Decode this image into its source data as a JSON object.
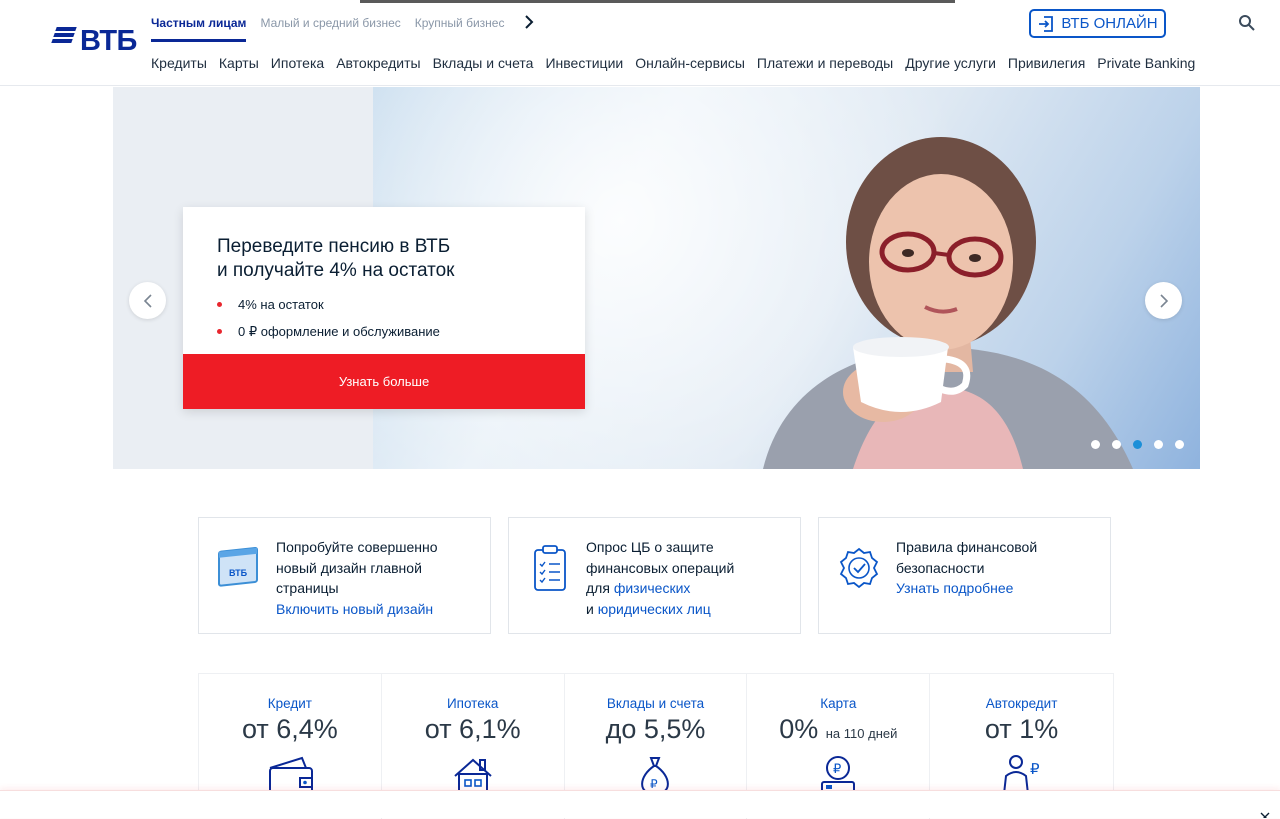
{
  "brand": {
    "logo_text": "ВТБ",
    "color": "#0a2896"
  },
  "segments": [
    {
      "label": "Частным лицам",
      "active": true
    },
    {
      "label": "Малый и средний бизнес",
      "active": false
    },
    {
      "label": "Крупный бизнес",
      "active": false
    }
  ],
  "header": {
    "online_label": "ВТБ ОНЛАЙН",
    "accent": "#0a56c8"
  },
  "nav": [
    "Кредиты",
    "Карты",
    "Ипотека",
    "Автокредиты",
    "Вклады и счета",
    "Инвестиции",
    "Онлайн-сервисы",
    "Платежи и переводы",
    "Другие услуги",
    "Привилегия",
    "Private Banking"
  ],
  "hero": {
    "title_line1": "Переведите пенсию в ВТБ",
    "title_line2": "и получайте 4% на остаток",
    "bullets": [
      "4% на остаток",
      "0 ₽ оформление и обслуживание"
    ],
    "cta": "Узнать больше",
    "cta_color": "#ee1c25",
    "slides_total": 5,
    "active_slide": 3
  },
  "info_cards": [
    {
      "text_line": "Попробуйте совершенно новый дизайн главной страницы",
      "link": "Включить новый дизайн"
    },
    {
      "text_line": "Опрос ЦБ о защите финансовых операций",
      "prefix1": "для ",
      "link1": "физических",
      "prefix2": "и ",
      "link2": "юридических лиц"
    },
    {
      "text_line": "Правила финансовой безопасности",
      "link": "Узнать подробнее"
    }
  ],
  "products": [
    {
      "name": "Кредит",
      "rate": "от 6,4%",
      "suffix": ""
    },
    {
      "name": "Ипотека",
      "rate": "от 6,1%",
      "suffix": ""
    },
    {
      "name": "Вклады и счета",
      "rate": "до 5,5%",
      "suffix": ""
    },
    {
      "name": "Карта",
      "rate": "0%",
      "suffix": "на 110 дней"
    },
    {
      "name": "Автокредит",
      "rate": "от 1%",
      "suffix": ""
    }
  ]
}
